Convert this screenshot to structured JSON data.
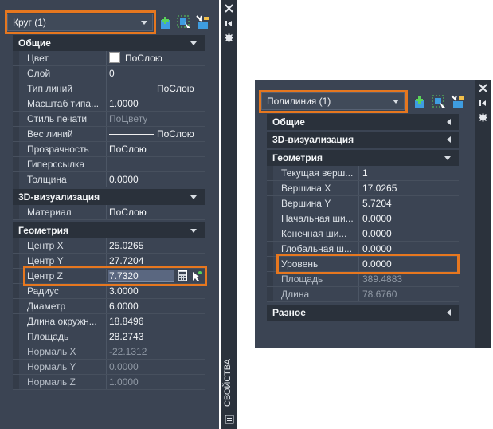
{
  "left": {
    "selector": "Круг (1)",
    "side_tab": "СВОЙСТВА",
    "categories": [
      {
        "title": "Общие",
        "rows": [
          {
            "key": "Цвет",
            "value": "ПоСлою"
          },
          {
            "key": "Слой",
            "value": "0"
          },
          {
            "key": "Тип линий",
            "value": "ПоСлою"
          },
          {
            "key": "Масштаб типа...",
            "value": "1.0000"
          },
          {
            "key": "Стиль печати",
            "value": "ПоЦвету"
          },
          {
            "key": "Вес линий",
            "value": "ПоСлою"
          },
          {
            "key": "Прозрачность",
            "value": "ПоСлою"
          },
          {
            "key": "Гиперссылка",
            "value": ""
          },
          {
            "key": "Толщина",
            "value": "0.0000"
          }
        ]
      },
      {
        "title": "3D-визуализация",
        "rows": [
          {
            "key": "Материал",
            "value": "ПоСлою"
          }
        ]
      },
      {
        "title": "Геометрия",
        "rows": [
          {
            "key": "Центр X",
            "value": "25.0265"
          },
          {
            "key": "Центр Y",
            "value": "27.7204"
          },
          {
            "key": "Центр Z",
            "value": "7.7320"
          },
          {
            "key": "Радиус",
            "value": "3.0000"
          },
          {
            "key": "Диаметр",
            "value": "6.0000"
          },
          {
            "key": "Длина окружн...",
            "value": "18.8496"
          },
          {
            "key": "Площадь",
            "value": "28.2743"
          },
          {
            "key": "Нормаль X",
            "value": "-22.1312"
          },
          {
            "key": "Нормаль Y",
            "value": "0.0000"
          },
          {
            "key": "Нормаль Z",
            "value": "1.0000"
          }
        ]
      }
    ]
  },
  "right": {
    "selector": "Полилиния (1)",
    "categories": [
      {
        "title": "Общие"
      },
      {
        "title": "3D-визуализация"
      },
      {
        "title": "Геометрия",
        "rows": [
          {
            "key": "Текущая верш...",
            "value": "1"
          },
          {
            "key": "Вершина X",
            "value": "17.0265"
          },
          {
            "key": "Вершина Y",
            "value": "5.7204"
          },
          {
            "key": "Начальная ши...",
            "value": "0.0000"
          },
          {
            "key": "Конечная ши...",
            "value": "0.0000"
          },
          {
            "key": "Глобальная ш...",
            "value": "0.0000"
          },
          {
            "key": "Уровень",
            "value": "0.0000"
          },
          {
            "key": "Площадь",
            "value": "389.4883"
          },
          {
            "key": "Длина",
            "value": "78.6760"
          }
        ]
      },
      {
        "title": "Разное"
      }
    ]
  },
  "colors": {
    "highlight": "#e6771f",
    "panel": "#3b4453",
    "header": "#2a313b"
  }
}
